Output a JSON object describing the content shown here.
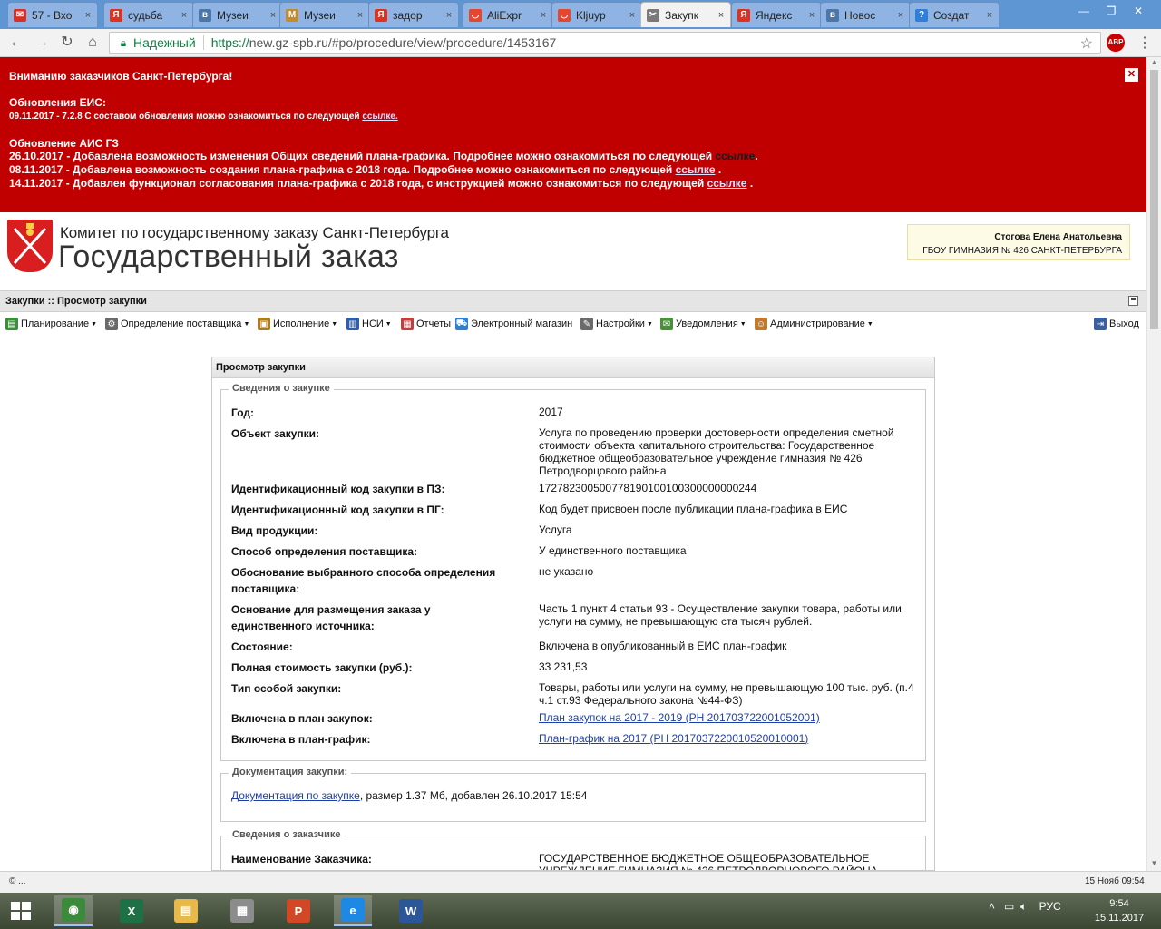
{
  "browser": {
    "tabs": [
      {
        "label": "57 - Вхо",
        "fav": "gmail-icon",
        "fav_color": "#d93025",
        "fav_char": "✉"
      },
      {
        "label": "судьба",
        "fav": "yandex-icon",
        "fav_color": "#e0301e",
        "fav_char": "Я"
      },
      {
        "label": "Музеи",
        "fav": "vk-icon",
        "fav_color": "#4a76a8",
        "fav_char": "в"
      },
      {
        "label": "Музеи",
        "fav": "m-icon",
        "fav_color": "#c28b2c",
        "fav_char": "M"
      },
      {
        "label": "задор",
        "fav": "yandex-icon",
        "fav_color": "#e0301e",
        "fav_char": "Я"
      },
      {
        "label": "AliExpr",
        "fav": "aliexpress-icon",
        "fav_color": "#e8452f",
        "fav_char": "◡"
      },
      {
        "label": "Kljuyp",
        "fav": "aliexpress-icon",
        "fav_color": "#e8452f",
        "fav_char": "◡"
      },
      {
        "label": "Закупк",
        "fav": "tools-icon",
        "fav_color": "#7a7a7a",
        "fav_char": "✂",
        "active": true
      },
      {
        "label": "Яндекс",
        "fav": "yandex-icon",
        "fav_color": "#e0301e",
        "fav_char": "Я"
      },
      {
        "label": "Новос",
        "fav": "vk-icon",
        "fav_color": "#4a76a8",
        "fav_char": "в"
      },
      {
        "label": "Создат",
        "fav": "help-icon",
        "fav_color": "#2f7fd8",
        "fav_char": "?"
      }
    ],
    "secure_label": "Надежный",
    "url_scheme": "https://",
    "url_rest": "new.gz-spb.ru/#po/procedure/view/procedure/1453167",
    "abp_label": "ABP"
  },
  "banner": {
    "title": "Вниманию заказчиков Санкт-Петербурга!",
    "eis_heading": "Обновления ЕИС:",
    "eis_line": "09.11.2017 - 7.2.8 С составом обновления можно ознакомиться по следующей",
    "eis_link": "ссылке.",
    "ais_heading": "Обновление АИС ГЗ",
    "news": [
      {
        "text": "26.10.2017 - Добавлена возможность изменения Общих сведений плана-графика. Подробнее можно ознакомиться по следующей",
        "link": "ссылке",
        "tail": "."
      },
      {
        "text": "08.11.2017 - Добавлена возможность создания плана-графика с 2018 года. Подробнее можно ознакомиться по следующей",
        "link": "ссылке",
        "tail": " ."
      },
      {
        "text": "14.11.2017 - Добавлен функционал согласования плана-графика с 2018 года, с инструкцией можно ознакомиться по следующей",
        "link": "ссылке",
        "tail": " ."
      }
    ],
    "close_label": "✕"
  },
  "header": {
    "org_line": "Комитет по государственному заказу Санкт-Петербурга",
    "site_title": "Государственный заказ",
    "user_name": "Стогова Елена Анатольевна",
    "user_org": "ГБОУ ГИМНАЗИЯ № 426 САНКТ-ПЕТЕРБУРГА"
  },
  "breadcrumb": "Закупки :: Просмотр закупки",
  "toolbar": {
    "items": [
      {
        "label": "Планирование",
        "icon": "planning-icon",
        "caret": true
      },
      {
        "label": "Определение поставщика",
        "icon": "gears-icon",
        "caret": true
      },
      {
        "label": "Исполнение",
        "icon": "execution-icon",
        "caret": true
      },
      {
        "label": "НСИ",
        "icon": "book-icon",
        "caret": true
      },
      {
        "label": "Отчеты",
        "icon": "report-icon",
        "caret": false
      },
      {
        "label": "Электронный магазин",
        "icon": "cart-icon",
        "caret": false
      },
      {
        "label": "Настройки",
        "icon": "wrench-icon",
        "caret": true
      },
      {
        "label": "Уведомления",
        "icon": "notification-icon",
        "caret": true
      },
      {
        "label": "Администрирование",
        "icon": "admin-icon",
        "caret": true
      }
    ],
    "logout": "Выход"
  },
  "panel": {
    "title": "Просмотр закупки",
    "purchase_legend": "Сведения о закупке",
    "fields": {
      "year_label": "Год:",
      "year_value": "2017",
      "object_label": "Объект закупки:",
      "object_value": "Услуга по проведению проверки достоверности определения сметной стоимости объекта капитального строительства: Государственное бюджетное общеобразовательное учреждение гимназия № 426 Петродворцового района",
      "ikz_pz_label": "Идентификационный код закупки в ПЗ:",
      "ikz_pz_value": "172782300500778190100100300000000244",
      "ikz_pg_label": "Идентификационный код закупки в ПГ:",
      "ikz_pg_value": "Код будет присвоен после публикации плана-графика в ЕИС",
      "product_label": "Вид продукции:",
      "product_value": "Услуга",
      "method_label": "Способ определения поставщика:",
      "method_value": "У единственного поставщика",
      "justification_label": "Обоснование выбранного способа определения поставщика:",
      "justification_value": "не указано",
      "basis_label": "Основание для размещения заказа у единственного источника:",
      "basis_value": "Часть 1 пункт 4 статьи 93 - Осуществление закупки товара, работы или услуги на сумму, не превышающую ста тысяч рублей.",
      "state_label": "Состояние:",
      "state_value": "Включена в опубликованный в ЕИС план-график",
      "cost_label": "Полная стоимость закупки (руб.):",
      "cost_value": "33 231,53",
      "special_label": "Тип особой закупки:",
      "special_value": "Товары, работы или услуги на сумму, не превышающую 100 тыс. руб. (п.4 ч.1 ст.93 Федерального закона №44-ФЗ)",
      "plan_label": "Включена в план закупок:",
      "plan_link": "План закупок на 2017 - 2019 (РН 201703722001052001)",
      "schedule_label": "Включена в план-график:",
      "schedule_link": "План-график на 2017 (РН 2017037220010520010001)"
    },
    "docs_legend": "Документация закупки:",
    "docs_link": "Документация по закупке",
    "docs_info": ", размер 1.37 Мб, добавлен 26.10.2017 15:54",
    "customer_legend": "Сведения о заказчике",
    "customer_name_label": "Наименование Заказчика:",
    "customer_name_value": "ГОСУДАРСТВЕННОЕ БЮДЖЕТНОЕ ОБЩЕОБРАЗОВАТЕЛЬНОЕ УЧРЕЖДЕНИЕ ГИМНАЗИЯ № 426 ПЕТРОДВОРЦОВОГО РАЙОНА САНКТ-"
  },
  "statusbar": {
    "left": "© ...",
    "right": "15 Нояб 09:54"
  },
  "taskbar": {
    "apps": [
      {
        "name": "chrome-icon",
        "color": "#3c8a3c",
        "char": "◉",
        "active": true
      },
      {
        "name": "excel-icon",
        "color": "#1e7145",
        "char": "X"
      },
      {
        "name": "explorer-icon",
        "color": "#e8b84a",
        "char": "▤"
      },
      {
        "name": "scanner-icon",
        "color": "#8c8c8c",
        "char": "▦"
      },
      {
        "name": "powerpoint-icon",
        "color": "#d24726",
        "char": "P"
      },
      {
        "name": "ie-icon",
        "color": "#1e88e5",
        "char": "e",
        "active": true
      },
      {
        "name": "word-icon",
        "color": "#2b579a",
        "char": "W"
      }
    ],
    "lang": "РУС",
    "time": "9:54",
    "date": "15.11.2017"
  }
}
